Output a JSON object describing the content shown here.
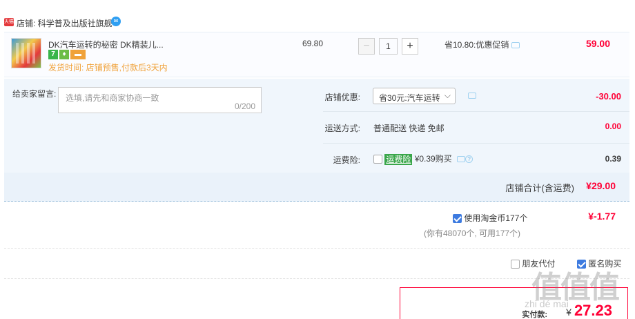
{
  "shop": {
    "badge": "天猫",
    "name": "店铺: 科学普及出版社旗舰",
    "wangwang_icon": "chat-bubble-icon"
  },
  "item": {
    "title": "DK汽车运转的秘密 DK精装儿...",
    "ship_time": "发货时间: 店铺预售,付款后3天内",
    "unit_price": "69.80",
    "quantity": "1",
    "minus": "−",
    "plus": "+",
    "promo": "省10.80:优惠促销",
    "price": "59.00",
    "service_icon_7": "7"
  },
  "message": {
    "label": "给卖家留言:",
    "placeholder": "选填,请先和商家协商一致",
    "counter": "0/200"
  },
  "options": {
    "shop_discount_label": "店铺优惠:",
    "shop_discount_value": "省30元:汽车运转",
    "shop_discount_amount": "-30.00",
    "shipping_label": "运送方式:",
    "shipping_value": "普通配送 快递 免邮",
    "shipping_amount": "0.00",
    "insurance_label": "运费险:",
    "insurance_tag": "运费险",
    "insurance_value": "¥0.39购买",
    "insurance_amount": "0.39"
  },
  "total": {
    "label": "店铺合计(含运费)",
    "amount": "¥29.00"
  },
  "coins": {
    "label": "使用淘金币177个",
    "note": "(你有48070个, 可用177个)",
    "amount": "¥-1.77"
  },
  "friend": {
    "friend_pay": "朋友代付",
    "anonymous": "匿名购买"
  },
  "pay": {
    "label": "实付款:",
    "yen": "¥",
    "amount": "27.23"
  },
  "watermark": {
    "text": "值值值",
    "url": "zhi dé mai"
  },
  "colors": {
    "price_red": "#ff0036",
    "panel_blue": "#f0f6fc",
    "ship_orange": "#f0a23a"
  }
}
